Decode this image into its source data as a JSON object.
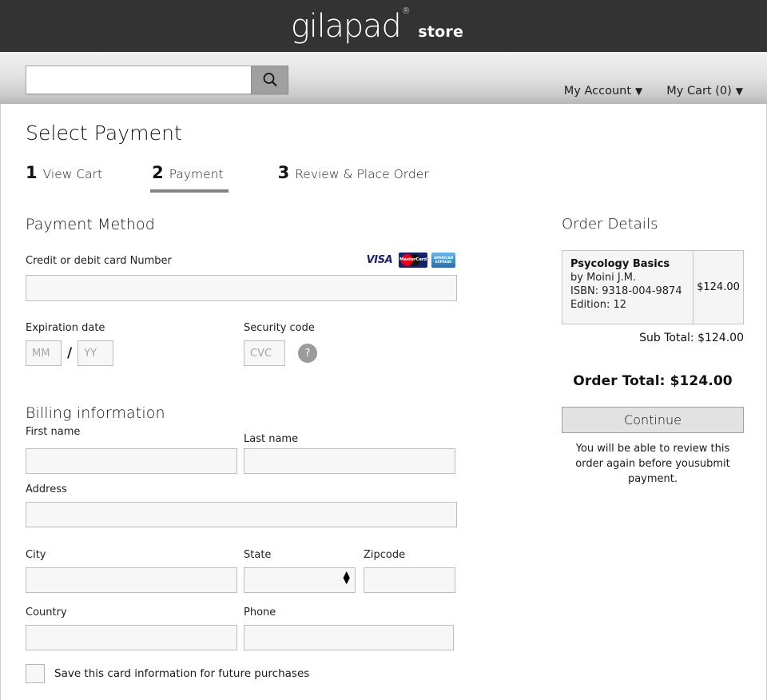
{
  "header": {
    "logo_text": "gilapad",
    "logo_registered": "®",
    "logo_suffix": "store"
  },
  "search": {
    "value": "",
    "placeholder": "",
    "icon": "search-icon"
  },
  "account_bar": {
    "my_account": "My Account",
    "my_cart": "My Cart (0)",
    "caret": "▼"
  },
  "page": {
    "title": "Select Payment"
  },
  "steps": [
    {
      "num": "1",
      "label": "View Cart",
      "active": false
    },
    {
      "num": "2",
      "label": "Payment",
      "active": true
    },
    {
      "num": "3",
      "label": "Review & Place Order",
      "active": false
    }
  ],
  "payment": {
    "section_title": "Payment Method",
    "card_number_label": "Credit or debit card Number",
    "card_number_value": "",
    "card_brands": [
      {
        "name": "visa-logo",
        "text": "VISA"
      },
      {
        "name": "mastercard-logo",
        "text": "MasterCard"
      },
      {
        "name": "amex-logo",
        "text": "AMERICAN EXPRESS"
      }
    ],
    "expiration_label": "Expiration date",
    "month_placeholder": "MM",
    "month_value": "",
    "separator": "/",
    "year_placeholder": "YY",
    "year_value": "",
    "security_label": "Security code",
    "cvc_placeholder": "CVC",
    "cvc_value": "",
    "help_icon_text": "?"
  },
  "billing": {
    "section_title": "Billing information",
    "first_name_label": "First name",
    "first_name_value": "",
    "last_name_label": "Last name",
    "last_name_value": "",
    "address_label": "Address",
    "address_value": "",
    "city_label": "City",
    "city_value": "",
    "state_label": "State",
    "state_value": "",
    "zipcode_label": "Zipcode",
    "zipcode_value": "",
    "country_label": "Country",
    "country_value": "",
    "phone_label": "Phone",
    "phone_value": "",
    "save_card_label": "Save this card information for future purchases",
    "save_card_checked": false
  },
  "order": {
    "heading": "Order Details",
    "item": {
      "title": "Psycology Basics",
      "author": "by Moini J.M.",
      "isbn": "ISBN: 9318-004-9874",
      "edition": "Edition: 12",
      "price": "$124.00"
    },
    "subtotal": "Sub Total: $124.00",
    "total": "Order Total: $124.00",
    "continue_label": "Continue",
    "note": "You will be able to review this order again before yousubmit payment."
  },
  "colors": {
    "header_bg": "#333333",
    "accent_underline": "#858585",
    "field_bg": "#f7f7f7",
    "field_border": "#bdbdbd",
    "button_bg": "#e2e2e2",
    "help_icon_bg": "#9b9b9b"
  }
}
